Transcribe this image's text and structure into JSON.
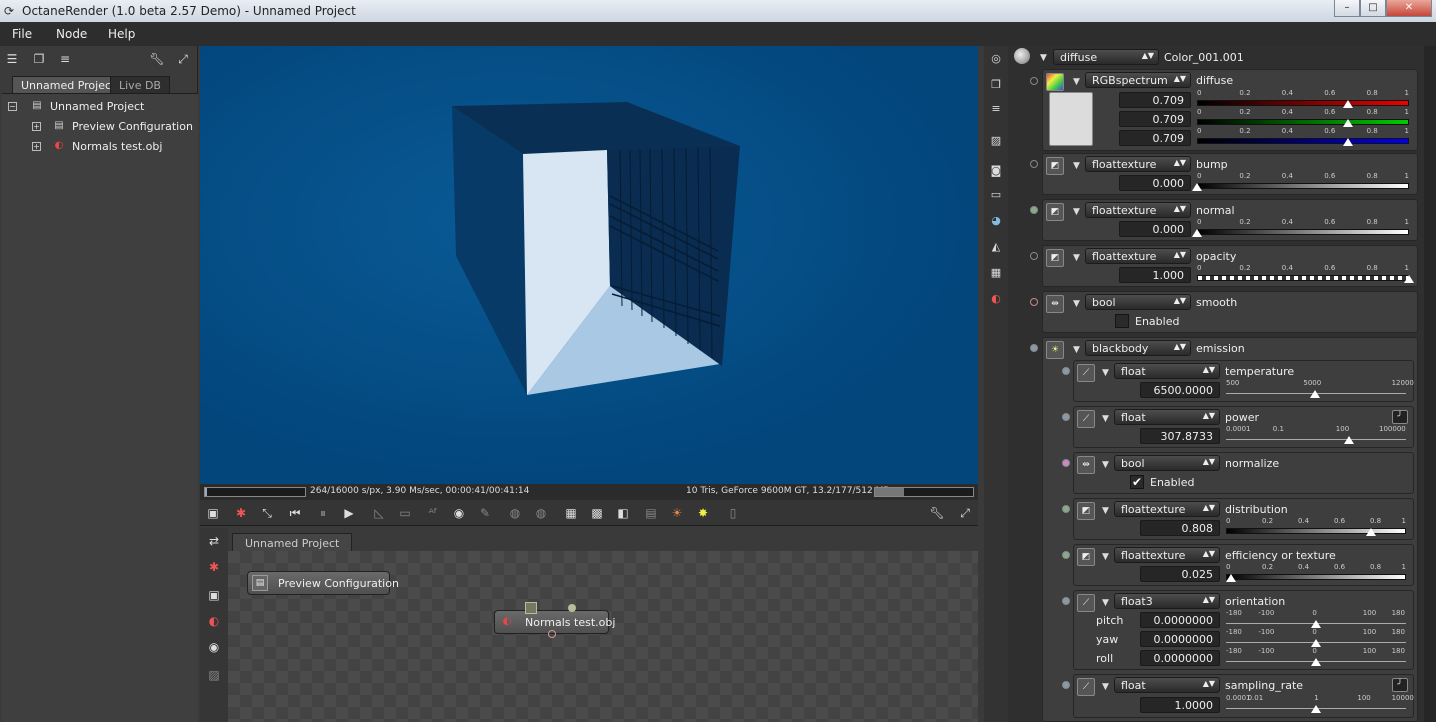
{
  "window": {
    "title": "OctaneRender (1.0 beta 2.57 Demo) - Unnamed Project",
    "minimize": "–",
    "maximize": "□",
    "close": "✕"
  },
  "menu": {
    "file": "File",
    "node": "Node",
    "help": "Help"
  },
  "left_panel": {
    "tabs": [
      "Unnamed Project",
      "Live DB"
    ],
    "tree": {
      "root": "Unnamed Project",
      "children": [
        "Preview Configuration",
        "Normals test.obj"
      ]
    }
  },
  "render_status": {
    "progress_fraction": 0.0165,
    "stats": "264/16000 s/px, 3.90 Ms/sec, 00:00:41/00:41:14",
    "gpu": "10 Tris, GeForce 9600M GT, 13.2/177/512 MB",
    "memory_fraction": 0.3
  },
  "node_graph": {
    "tab": "Unnamed Project",
    "nodes": [
      "Preview Configuration",
      "Normals test.obj"
    ]
  },
  "material": {
    "type": "diffuse",
    "name": "Color_001.001",
    "diffuse": {
      "type": "RGBspectrum",
      "label": "diffuse",
      "r": "0.709",
      "g": "0.709",
      "b": "0.709",
      "swatch_color": "#dcdcdc",
      "ticks": [
        "0",
        "0.2",
        "0.4",
        "0.6",
        "0.8",
        "1"
      ]
    },
    "bump": {
      "type": "floattexture",
      "label": "bump",
      "value": "0.000",
      "fraction": 0.0,
      "ticks": [
        "0",
        "0.2",
        "0.4",
        "0.6",
        "0.8",
        "1"
      ]
    },
    "normal": {
      "type": "floattexture",
      "label": "normal",
      "value": "0.000",
      "fraction": 0.0,
      "ticks": [
        "0",
        "0.2",
        "0.4",
        "0.6",
        "0.8",
        "1"
      ]
    },
    "opacity": {
      "type": "floattexture",
      "label": "opacity",
      "value": "1.000",
      "fraction": 1.0,
      "ticks": [
        "0",
        "0.2",
        "0.4",
        "0.6",
        "0.8",
        "1"
      ]
    },
    "smooth": {
      "type": "bool",
      "label": "smooth",
      "checkbox": "Enabled",
      "checked": false
    },
    "emission": {
      "type": "blackbody",
      "label": "emission",
      "temperature": {
        "type": "float",
        "label": "temperature",
        "value": "6500.0000",
        "ticks": [
          "500",
          "5000",
          "12000"
        ]
      },
      "power": {
        "type": "float",
        "label": "power",
        "value": "307.8733",
        "ticks": [
          "0.0001",
          "0.1",
          "100",
          "100000"
        ]
      },
      "normalize": {
        "type": "bool",
        "label": "normalize",
        "checkbox": "Enabled",
        "checked": true
      },
      "distribution": {
        "type": "floattexture",
        "label": "distribution",
        "value": "0.808",
        "fraction": 0.808,
        "ticks": [
          "0",
          "0.2",
          "0.4",
          "0.6",
          "0.8",
          "1"
        ]
      },
      "efficiency": {
        "type": "floattexture",
        "label": "efficiency or texture",
        "value": "0.025",
        "fraction": 0.025,
        "ticks": [
          "0",
          "0.2",
          "0.4",
          "0.6",
          "0.8",
          "1"
        ]
      },
      "orientation": {
        "type": "float3",
        "label": "orientation",
        "pitch": {
          "label": "pitch",
          "value": "0.0000000"
        },
        "yaw": {
          "label": "yaw",
          "value": "0.0000000"
        },
        "roll": {
          "label": "roll",
          "value": "0.0000000"
        },
        "ticks": [
          "-180",
          "-100",
          "0",
          "100",
          "180"
        ]
      },
      "sampling_rate": {
        "type": "float",
        "label": "sampling_rate",
        "value": "1.0000",
        "ticks": [
          "0.0001",
          "0.01",
          "1",
          "100",
          "10000"
        ]
      }
    }
  }
}
